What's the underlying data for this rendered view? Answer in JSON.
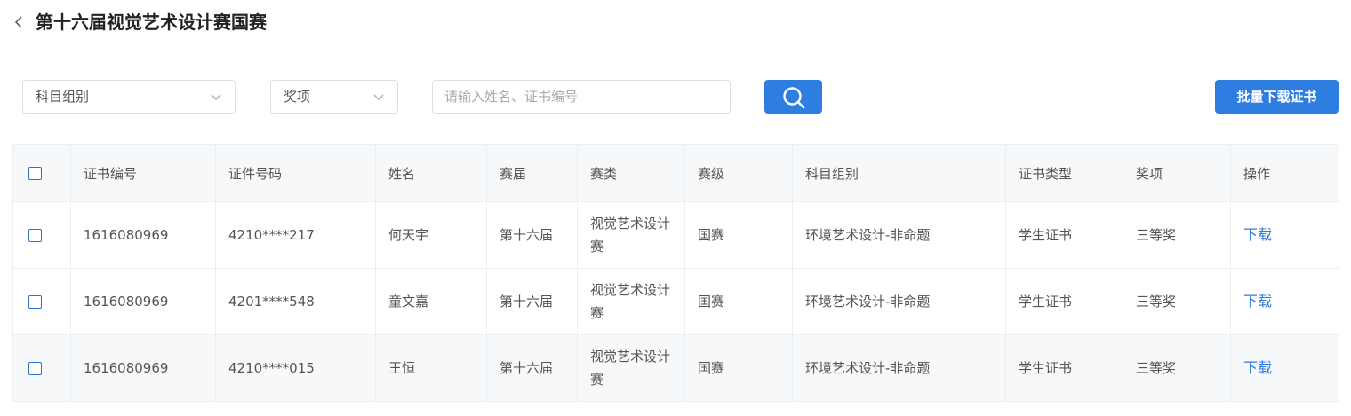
{
  "header": {
    "title": "第十六届视觉艺术设计赛国赛",
    "back_icon": "chevron-left-icon"
  },
  "filters": {
    "subject_group": {
      "value": "科目组别",
      "icon": "chevron-down-icon"
    },
    "award": {
      "value": "奖项",
      "icon": "chevron-down-icon"
    },
    "search": {
      "placeholder": "请输入姓名、证书编号",
      "value": ""
    },
    "search_button_icon": "search-icon",
    "batch_download_label": "批量下载证书"
  },
  "colors": {
    "accent": "#2e7de1",
    "header_bg": "#f7f8fa",
    "border": "#ebeef5"
  },
  "table": {
    "columns": [
      "证书编号",
      "证件号码",
      "姓名",
      "赛届",
      "赛类",
      "赛级",
      "科目组别",
      "证书类型",
      "奖项",
      "操作"
    ],
    "rows": [
      {
        "cert_no": "1616080969",
        "id_no": "4210****217",
        "name": "何天宇",
        "session": "第十六届",
        "category": "视觉艺术设计赛",
        "level": "国赛",
        "subject": "环境艺术设计-非命题",
        "cert_type": "学生证书",
        "award": "三等奖",
        "action": "下载"
      },
      {
        "cert_no": "1616080969",
        "id_no": "4201****548",
        "name": "童文嘉",
        "session": "第十六届",
        "category": "视觉艺术设计赛",
        "level": "国赛",
        "subject": "环境艺术设计-非命题",
        "cert_type": "学生证书",
        "award": "三等奖",
        "action": "下载"
      },
      {
        "cert_no": "1616080969",
        "id_no": "4210****015",
        "name": "王恒",
        "session": "第十六届",
        "category": "视觉艺术设计赛",
        "level": "国赛",
        "subject": "环境艺术设计-非命题",
        "cert_type": "学生证书",
        "award": "三等奖",
        "action": "下载"
      }
    ]
  }
}
